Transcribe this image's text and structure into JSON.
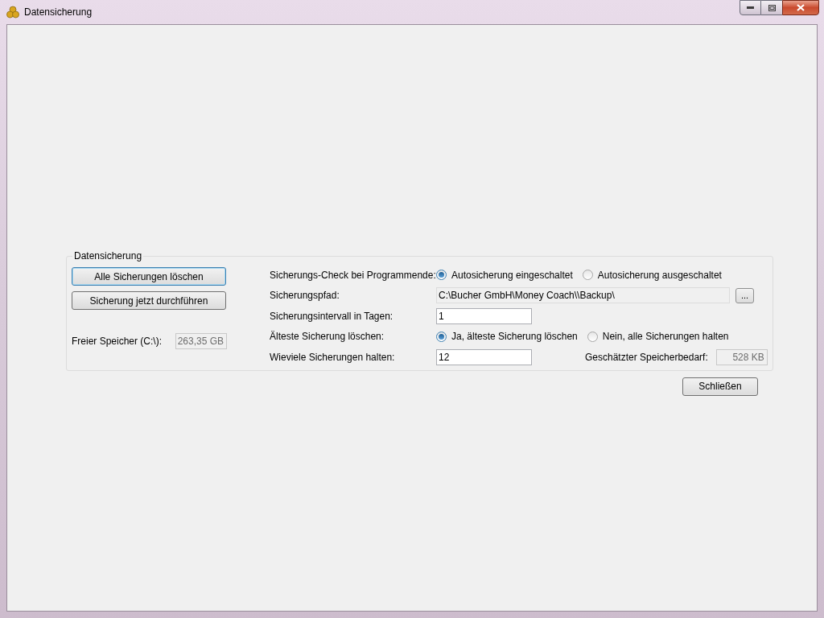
{
  "window": {
    "title": "Datensicherung"
  },
  "group": {
    "title": "Datensicherung",
    "buttons": [
      {
        "label": "Alle Sicherungen löschen",
        "focused": true
      },
      {
        "label": "Sicherung jetzt durchführen",
        "focused": false
      }
    ],
    "free_space": {
      "label": "Freier Speicher (C:\\):",
      "value": "263,35 GB"
    },
    "settings": [
      {
        "kind": "radio",
        "label": "Sicherungs-Check bei Programmende:",
        "options": [
          {
            "label": "Autosicherung eingeschaltet",
            "selected": true
          },
          {
            "label": "Autosicherung ausgeschaltet",
            "selected": false
          }
        ]
      },
      {
        "kind": "path",
        "label": "Sicherungspfad:",
        "value": "C:\\Bucher GmbH\\Money Coach\\\\Backup\\",
        "browse": "..."
      },
      {
        "kind": "input",
        "label": "Sicherungsintervall in Tagen:",
        "value": "1"
      },
      {
        "kind": "radio",
        "label": "Älteste Sicherung löschen:",
        "options": [
          {
            "label": "Ja, älteste Sicherung löschen",
            "selected": true
          },
          {
            "label": "Nein, alle Sicherungen halten",
            "selected": false
          }
        ]
      },
      {
        "kind": "input",
        "label": "Wieviele Sicherungen halten:",
        "value": "12",
        "extra": {
          "label": "Geschätzter Speicherbedarf:",
          "value": "528 KB"
        }
      }
    ]
  },
  "close_button": "Schließen"
}
